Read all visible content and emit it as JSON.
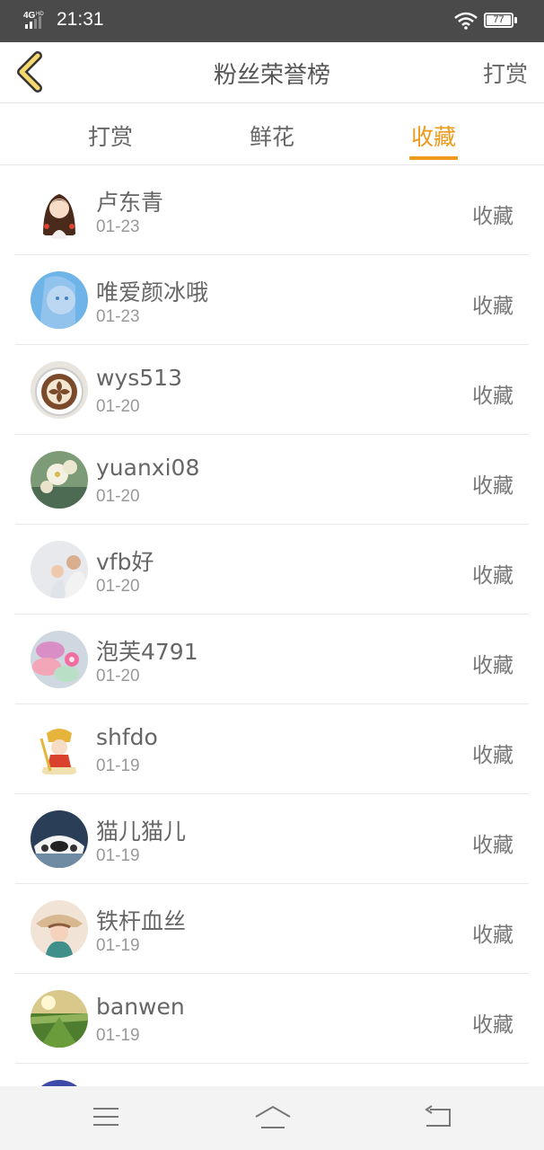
{
  "status_bar": {
    "network": "4G HD",
    "time": "21:31",
    "battery": "77"
  },
  "header": {
    "title": "粉丝荣誉榜",
    "action": "打赏",
    "back_icon": "chevron-left-icon"
  },
  "tabs": [
    {
      "label": "打赏",
      "active": false
    },
    {
      "label": "鲜花",
      "active": false
    },
    {
      "label": "收藏",
      "active": true
    }
  ],
  "accent_color": "#ee9a1c",
  "fans": [
    {
      "name": "卢东青",
      "date": "01-23",
      "action": "收藏"
    },
    {
      "name": "唯爱颜冰哦",
      "date": "01-23",
      "action": "收藏"
    },
    {
      "name": "wys513",
      "date": "01-20",
      "action": "收藏"
    },
    {
      "name": "yuanxi08",
      "date": "01-20",
      "action": "收藏"
    },
    {
      "name": "vfb好",
      "date": "01-20",
      "action": "收藏"
    },
    {
      "name": "泡芙4791",
      "date": "01-20",
      "action": "收藏"
    },
    {
      "name": "shfdo",
      "date": "01-19",
      "action": "收藏"
    },
    {
      "name": "猫儿猫儿",
      "date": "01-19",
      "action": "收藏"
    },
    {
      "name": "铁杆血丝",
      "date": "01-19",
      "action": "收藏"
    },
    {
      "name": "banwen",
      "date": "01-19",
      "action": "收藏"
    }
  ],
  "nav": {
    "menu_icon": "menu-icon",
    "home_icon": "home-icon",
    "back_icon": "back-arrow-icon"
  }
}
